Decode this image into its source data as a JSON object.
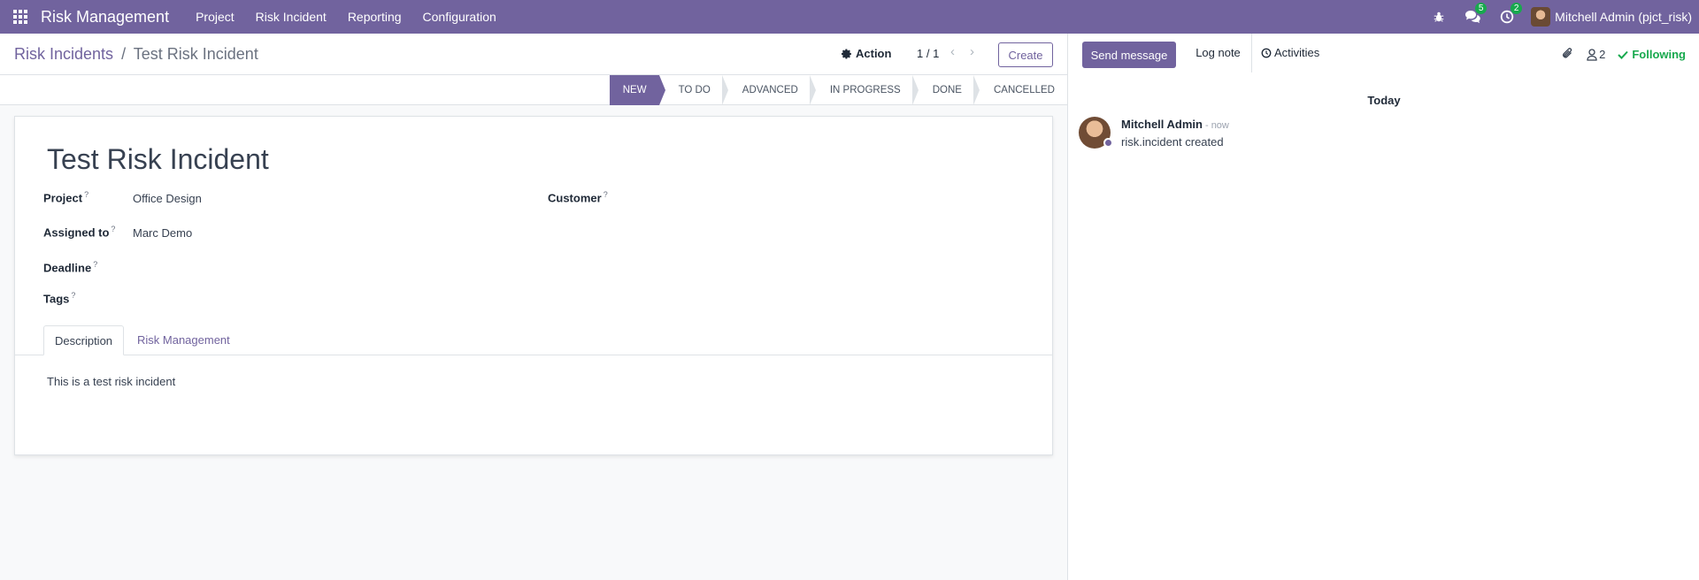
{
  "navbar": {
    "app_name": "Risk Management",
    "menu": [
      "Project",
      "Risk Incident",
      "Reporting",
      "Configuration"
    ],
    "messages_count": "5",
    "activities_count": "2",
    "user_name": "Mitchell Admin (pjct_risk)"
  },
  "control_panel": {
    "breadcrumb_parent": "Risk Incidents",
    "breadcrumb_sep": "/",
    "breadcrumb_current": "Test Risk Incident",
    "action_label": "Action",
    "pager": "1 / 1",
    "create_label": "Create"
  },
  "stages": [
    "NEW",
    "TO DO",
    "ADVANCED",
    "IN PROGRESS",
    "DONE",
    "CANCELLED"
  ],
  "form": {
    "title": "Test Risk Incident",
    "project_label": "Project",
    "project_value": "Office Design",
    "assigned_label": "Assigned to",
    "assigned_value": "Marc Demo",
    "deadline_label": "Deadline",
    "tags_label": "Tags",
    "customer_label": "Customer",
    "help_mark": "?",
    "tabs": [
      "Description",
      "Risk Management"
    ],
    "description": "This is a test risk incident"
  },
  "chatter": {
    "send_message": "Send message",
    "log_note": "Log note",
    "activities": "Activities",
    "followers_count": "2",
    "following": "Following",
    "today": "Today",
    "message": {
      "author": "Mitchell Admin",
      "date": "- now",
      "body": "risk.incident created"
    }
  },
  "colors": {
    "brand": "#71639e",
    "success": "#17a94d"
  }
}
